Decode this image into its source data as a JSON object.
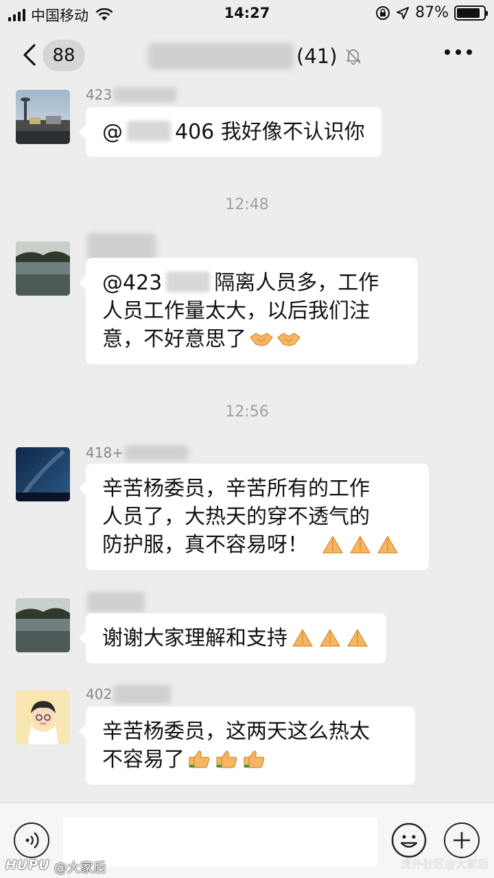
{
  "status_bar": {
    "carrier": "中国移动",
    "time": "14:27",
    "battery_text": "87%",
    "battery_level": 0.87
  },
  "nav": {
    "back_count": "88",
    "member_count": "(41)",
    "icons": [
      "chevron-left-icon",
      "mute-bell-icon",
      "more-dots-icon"
    ]
  },
  "messages": [
    {
      "sender": "423",
      "parts": [
        "@",
        "406 我好像不认识你"
      ],
      "avatar": "tower-city-photo"
    },
    {
      "timestamp": "12:48"
    },
    {
      "sender": "",
      "lines": [
        "@423",
        "隔离人员多，工作",
        "人员工作量太大，以后我们注",
        "意，不好意思了"
      ],
      "emoji": [
        "handshake",
        "handshake"
      ],
      "avatar": "lake-photo"
    },
    {
      "timestamp": "12:56"
    },
    {
      "sender": "418+",
      "lines": [
        "辛苦杨委员，辛苦所有的工作",
        "人员了，大热天的穿不透气的",
        "防护服，真不容易呀！"
      ],
      "emoji": [
        "praying-hands",
        "praying-hands",
        "praying-hands"
      ],
      "avatar": "night-sky-photo"
    },
    {
      "sender": "",
      "lines": [
        "谢谢大家理解和支持"
      ],
      "emoji": [
        "praying-hands",
        "praying-hands",
        "praying-hands"
      ],
      "avatar": "lake-photo"
    },
    {
      "sender": "402",
      "lines": [
        "辛苦杨委员，这两天这么热太",
        "不容易了"
      ],
      "emoji": [
        "thumbs-up",
        "thumbs-up",
        "thumbs-up"
      ],
      "avatar": "cartoon-boy"
    }
  ],
  "input_bar": {
    "icons": [
      "voice-icon",
      "emoji-face-icon",
      "plus-icon"
    ]
  },
  "watermark": {
    "brand": "HUPU",
    "user": "@大家后",
    "right": "虎扑社区@大家后"
  }
}
